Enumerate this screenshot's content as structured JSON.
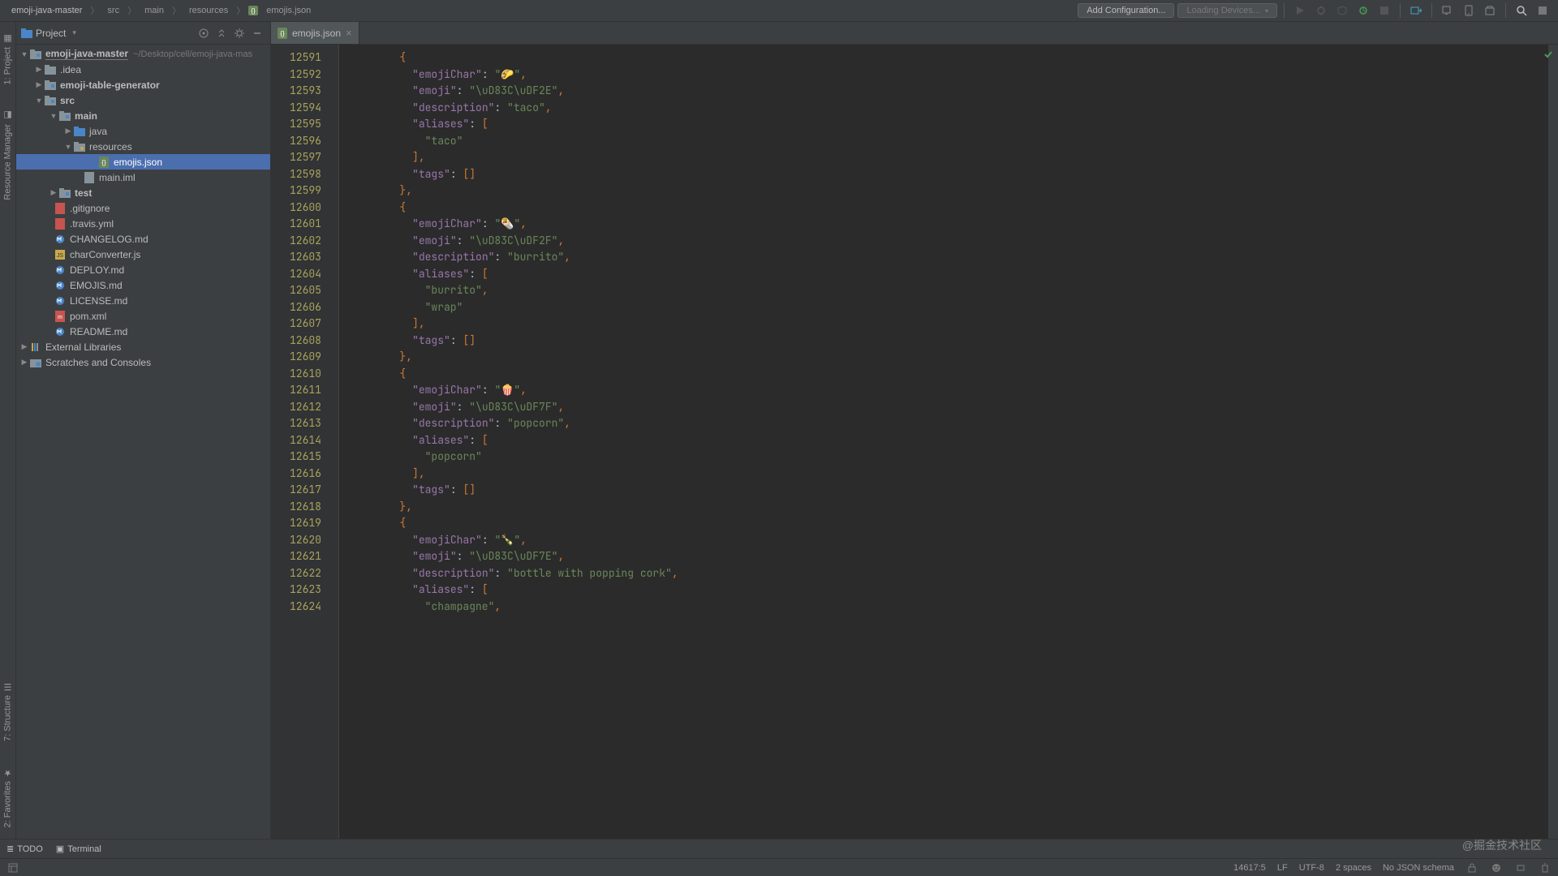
{
  "breadcrumb": [
    "emoji-java-master",
    "src",
    "main",
    "resources",
    "emojis.json"
  ],
  "nav": {
    "add_config": "Add Configuration...",
    "loading_devices": "Loading Devices..."
  },
  "panel": {
    "title": "Project",
    "root_name": "emoji-java-master",
    "root_path": "~/Desktop/cell/emoji-java-mas",
    "external_libs": "External Libraries",
    "scratches": "Scratches and Consoles"
  },
  "tree": {
    "idea": ".idea",
    "etg": "emoji-table-generator",
    "src": "src",
    "main": "main",
    "java": "java",
    "resources": "resources",
    "emojis": "emojis.json",
    "mainiml": "main.iml",
    "test": "test",
    "gitignore": ".gitignore",
    "travis": ".travis.yml",
    "changelog": "CHANGELOG.md",
    "charconv": "charConverter.js",
    "deploy": "DEPLOY.md",
    "emojismd": "EMOJIS.md",
    "license": "LICENSE.md",
    "pom": "pom.xml",
    "readme": "README.md"
  },
  "tab": {
    "name": "emojis.json"
  },
  "gutters": {
    "project": "1: Project",
    "resmgr": "Resource Manager",
    "structure": "7: Structure",
    "favorites": "2: Favorites"
  },
  "bottom": {
    "todo": "TODO",
    "terminal": "Terminal"
  },
  "status": {
    "pos": "14617:5",
    "le": "LF",
    "enc": "UTF-8",
    "indent": "2 spaces",
    "schema": "No JSON schema"
  },
  "code_lines": [
    {
      "n": 12591,
      "t": "        {"
    },
    {
      "n": 12592,
      "t": "          \"emojiChar\": \"🌮\","
    },
    {
      "n": 12593,
      "t": "          \"emoji\": \"\\uD83C\\uDF2E\","
    },
    {
      "n": 12594,
      "t": "          \"description\": \"taco\","
    },
    {
      "n": 12595,
      "t": "          \"aliases\": ["
    },
    {
      "n": 12596,
      "t": "            \"taco\""
    },
    {
      "n": 12597,
      "t": "          ],"
    },
    {
      "n": 12598,
      "t": "          \"tags\": []"
    },
    {
      "n": 12599,
      "t": "        },"
    },
    {
      "n": 12600,
      "t": "        {"
    },
    {
      "n": 12601,
      "t": "          \"emojiChar\": \"🌯\","
    },
    {
      "n": 12602,
      "t": "          \"emoji\": \"\\uD83C\\uDF2F\","
    },
    {
      "n": 12603,
      "t": "          \"description\": \"burrito\","
    },
    {
      "n": 12604,
      "t": "          \"aliases\": ["
    },
    {
      "n": 12605,
      "t": "            \"burrito\","
    },
    {
      "n": 12606,
      "t": "            \"wrap\""
    },
    {
      "n": 12607,
      "t": "          ],"
    },
    {
      "n": 12608,
      "t": "          \"tags\": []"
    },
    {
      "n": 12609,
      "t": "        },"
    },
    {
      "n": 12610,
      "t": "        {"
    },
    {
      "n": 12611,
      "t": "          \"emojiChar\": \"🍿\","
    },
    {
      "n": 12612,
      "t": "          \"emoji\": \"\\uD83C\\uDF7F\","
    },
    {
      "n": 12613,
      "t": "          \"description\": \"popcorn\","
    },
    {
      "n": 12614,
      "t": "          \"aliases\": ["
    },
    {
      "n": 12615,
      "t": "            \"popcorn\""
    },
    {
      "n": 12616,
      "t": "          ],"
    },
    {
      "n": 12617,
      "t": "          \"tags\": []"
    },
    {
      "n": 12618,
      "t": "        },"
    },
    {
      "n": 12619,
      "t": "        {"
    },
    {
      "n": 12620,
      "t": "          \"emojiChar\": \"🍾\","
    },
    {
      "n": 12621,
      "t": "          \"emoji\": \"\\uD83C\\uDF7E\","
    },
    {
      "n": 12622,
      "t": "          \"description\": \"bottle with popping cork\","
    },
    {
      "n": 12623,
      "t": "          \"aliases\": ["
    },
    {
      "n": 12624,
      "t": "            \"champagne\","
    }
  ],
  "watermark": "@掘金技术社区"
}
